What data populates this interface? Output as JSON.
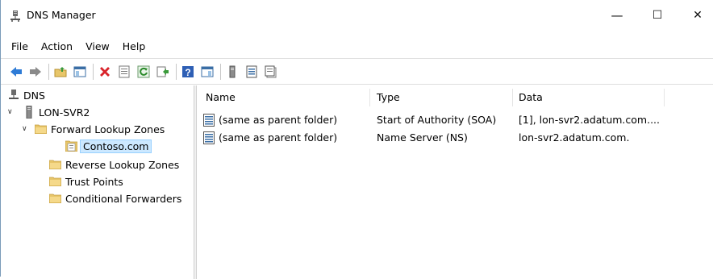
{
  "window": {
    "title": "DNS Manager",
    "minimize_glyph": "—",
    "maximize_glyph": "☐",
    "close_glyph": "✕"
  },
  "menu": [
    "File",
    "Action",
    "View",
    "Help"
  ],
  "toolbar": {
    "icons": [
      "back-icon",
      "forward-icon",
      "up-folder-icon",
      "show-hide-tree-icon",
      "delete-icon",
      "properties-icon",
      "refresh-icon",
      "export-list-icon",
      "help-icon",
      "show-hide-action-pane-icon",
      "server-icon",
      "list-view-icon",
      "detail-view-icon"
    ]
  },
  "tree": {
    "root": "DNS",
    "server": "LON-SVR2",
    "forward_zones": "Forward Lookup Zones",
    "zone_selected": "Contoso.com",
    "reverse_zones": "Reverse Lookup Zones",
    "trust_points": "Trust Points",
    "conditional_forwarders": "Conditional Forwarders"
  },
  "list": {
    "columns": [
      "Name",
      "Type",
      "Data"
    ],
    "rows": [
      {
        "name": "(same as parent folder)",
        "type": "Start of Authority (SOA)",
        "data": "[1], lon-svr2.adatum.com...."
      },
      {
        "name": "(same as parent folder)",
        "type": "Name Server (NS)",
        "data": "lon-svr2.adatum.com."
      }
    ]
  },
  "colors": {
    "selection_bg": "#cce8ff",
    "selection_border": "#99d1ff",
    "folder": "#e8c66a",
    "delete_red": "#d9232a",
    "nav_blue": "#2e7bd6"
  }
}
